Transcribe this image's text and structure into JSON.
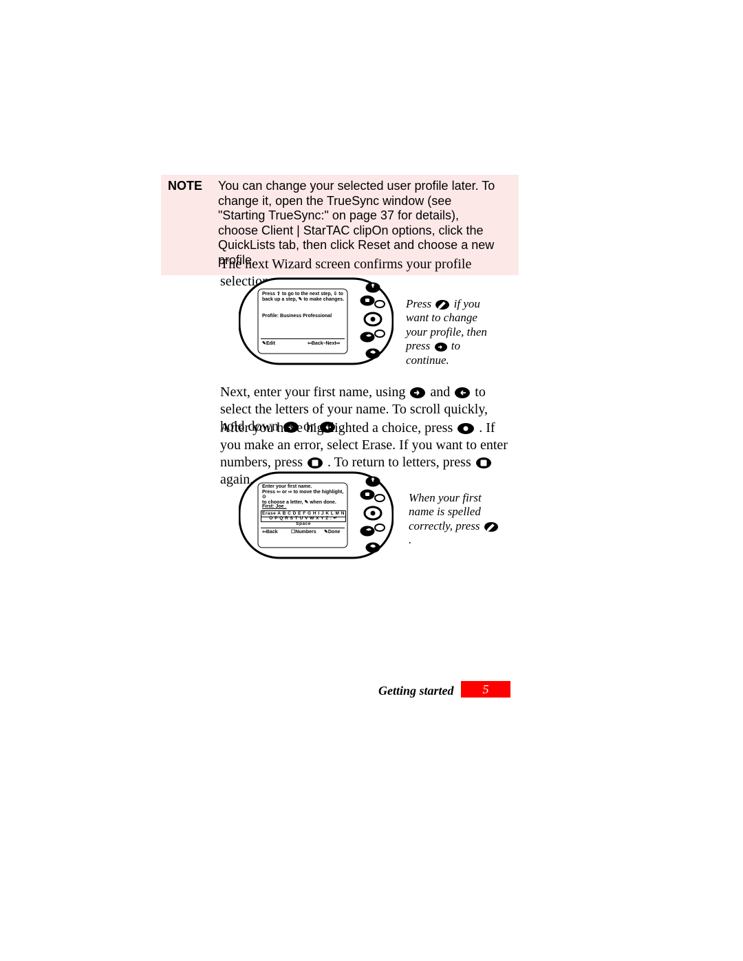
{
  "note": {
    "label": "NOTE",
    "body": "You can change your selected user profile later. To change it, open the TrueSync window (see \"Starting TrueSync:\" on page 37 for details), choose Client | StarTAC clipOn options, click the QuickLists tab, then click Reset and choose a new profile."
  },
  "para1": "The next Wizard screen confirms your profile selection.",
  "device1": {
    "line1": "Press ⇧ to go to the next step, ⇩ to",
    "line2": "back up a step, ✎ to make changes.",
    "profile": "Profile: Business Professional",
    "edit": "✎Edit",
    "backnext": "⇦Back–Next⇨"
  },
  "caption1": {
    "pre": "Press ",
    "mid1": " if you want to change your profile, then press ",
    "post": " to continue."
  },
  "para2": {
    "a": "Next, enter your first name, using ",
    "b": " and ",
    "c": " to select the letters of your name. To scroll quickly, hold down ",
    "d": " or ",
    "e": "."
  },
  "para3": {
    "a": "After you have highlighted a choice, press ",
    "b": ". If you make an error, select Erase. If you want to enter numbers, press ",
    "c": ". To return to letters, press ",
    "d": " again."
  },
  "device2": {
    "line1": "Enter your first name.",
    "line2": "Press ⇦ or ⇨ to move the highlight, ⊙",
    "line3": "to choose a letter, ✎ when done.",
    "first": "First: Joe_",
    "row1": "Erase  A B C D E F G H I J K L M N",
    "row2": "O P Q R S T U V W X Y Z . ↵ Space",
    "back": "⇦Back",
    "numbers": "☐Numbers",
    "done": "✎Done"
  },
  "caption2": {
    "a": "When your first name is spelled correctly, press ",
    "b": "."
  },
  "footer": {
    "title": "Getting started",
    "page": "5"
  }
}
